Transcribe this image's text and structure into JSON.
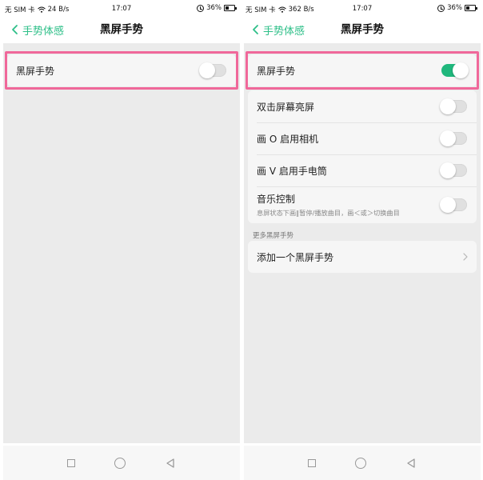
{
  "left": {
    "status": {
      "carrier": "无 SIM 卡",
      "speed": "24 B/s",
      "time": "17:07",
      "battery": "36%"
    },
    "header": {
      "back_label": "手势体感",
      "title": "黑屏手势"
    },
    "main_toggle": {
      "label": "黑屏手势",
      "on": false
    }
  },
  "right": {
    "status": {
      "carrier": "无 SIM 卡",
      "speed": "362 B/s",
      "time": "17:07",
      "battery": "36%"
    },
    "header": {
      "back_label": "手势体感",
      "title": "黑屏手势"
    },
    "main_toggle": {
      "label": "黑屏手势",
      "on": true
    },
    "gestures": [
      {
        "label": "双击屏幕亮屏",
        "on": false
      },
      {
        "label": "画 O 启用相机",
        "on": false
      },
      {
        "label": "画 V 启用手电筒",
        "on": false
      },
      {
        "label": "音乐控制",
        "sub": "息屏状态下画‖暂停/播放曲目，画＜或＞切换曲目",
        "on": false
      }
    ],
    "more_section": {
      "label": "更多黑屏手势",
      "add_label": "添加一个黑屏手势"
    }
  },
  "colors": {
    "accent": "#2dbf88",
    "toggle_on": "#1fb77c",
    "highlight": "#f0689a",
    "background": "#ebebeb"
  },
  "icons": {
    "back": "chevron-left-icon",
    "add_row": "chevron-right-icon",
    "nav": [
      "square-recents-icon",
      "circle-home-icon",
      "triangle-back-icon"
    ]
  }
}
